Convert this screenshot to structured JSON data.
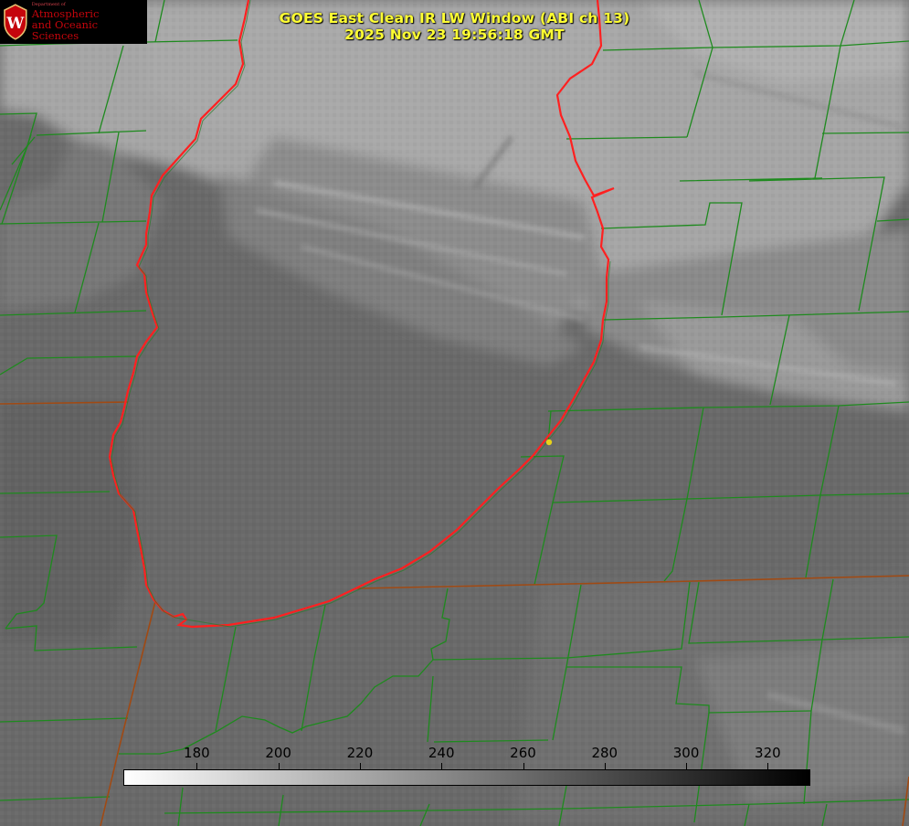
{
  "header": {
    "title_line1": "GOES East Clean IR LW Window (ABI ch 13)",
    "title_line2": "2025 Nov 23 19:56:18 GMT"
  },
  "logo": {
    "dept": "Department of",
    "line1": "Atmospheric",
    "line2": "and Oceanic Sciences",
    "seal_letter": "W"
  },
  "colorbar": {
    "ticks": [
      "180",
      "200",
      "220",
      "240",
      "260",
      "280",
      "300",
      "320"
    ],
    "tick_values": [
      180,
      200,
      220,
      240,
      260,
      280,
      300,
      320
    ],
    "range": [
      162,
      330
    ],
    "color_low": "#ffffff",
    "color_high": "#000000"
  },
  "map": {
    "county_line_color": "#1e8a1e",
    "coast_color": "#ff2020",
    "state_line_color": "#a04a14",
    "marker_color": "#e8d21a"
  }
}
